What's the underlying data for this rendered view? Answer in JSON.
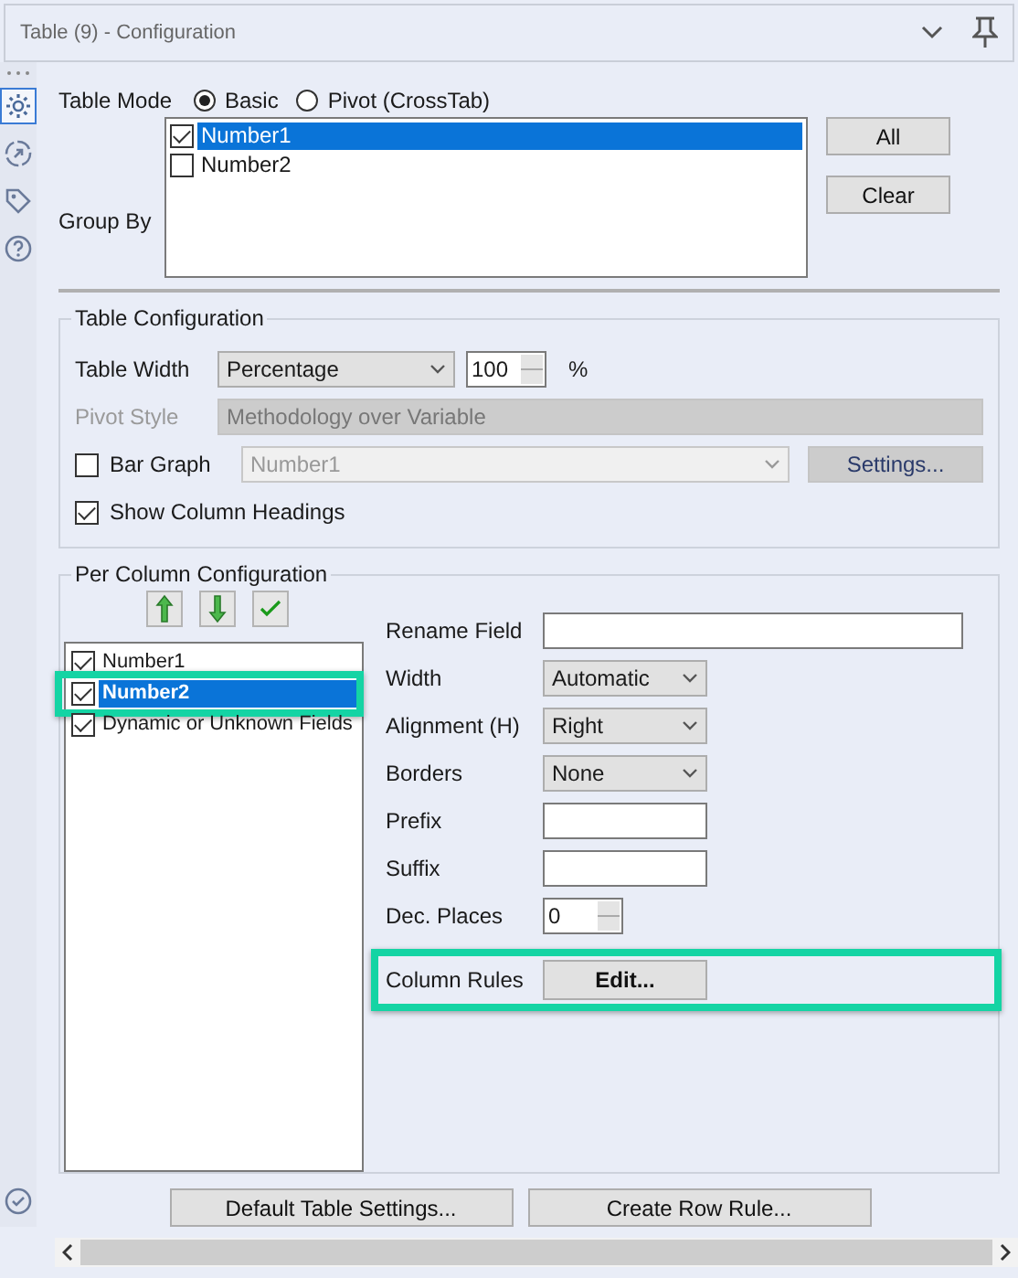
{
  "window": {
    "title": "Table (9) - Configuration"
  },
  "sidebar": {
    "items": [
      {
        "selected": true
      },
      {
        "selected": false
      },
      {
        "selected": false
      },
      {
        "selected": false
      }
    ]
  },
  "table_mode": {
    "label": "Table Mode",
    "options": [
      {
        "label": "Basic",
        "selected": true
      },
      {
        "label": "Pivot (CrossTab)",
        "selected": false
      }
    ]
  },
  "group_by": {
    "label": "Group By",
    "items": [
      {
        "label": "Number1",
        "checked": true,
        "selected": true
      },
      {
        "label": "Number2",
        "checked": false,
        "selected": false
      }
    ],
    "buttons": [
      "All",
      "Clear"
    ]
  },
  "table_configuration": {
    "title": "Table Configuration",
    "table_width": {
      "label": "Table Width",
      "value": "Percentage",
      "amount": "100",
      "unit": "%"
    },
    "pivot_style": {
      "label": "Pivot Style",
      "value": "Methodology over Variable",
      "disabled": true
    },
    "bar_graph": {
      "label": "Bar Graph",
      "checked": false,
      "value": "Number1",
      "disabled": true,
      "button": "Settings..."
    },
    "show_column_headings": {
      "label": "Show Column Headings",
      "checked": true
    }
  },
  "per_column": {
    "title": "Per Column Configuration",
    "fields": [
      {
        "label": "Number1",
        "checked": true,
        "selected": false,
        "highlighted": false
      },
      {
        "label": "Number2",
        "checked": true,
        "selected": true,
        "highlighted": true
      },
      {
        "label": "Dynamic or Unknown Fields",
        "checked": true,
        "selected": false,
        "highlighted": false
      }
    ],
    "settings": [
      {
        "kind": "text",
        "label": "Rename Field",
        "wide": true
      },
      {
        "kind": "select",
        "label": "Width",
        "value": "Automatic"
      },
      {
        "kind": "select",
        "label": "Alignment (H)",
        "value": "Right"
      },
      {
        "kind": "select",
        "label": "Borders",
        "value": "None"
      },
      {
        "kind": "text",
        "label": "Prefix"
      },
      {
        "kind": "text",
        "label": "Suffix"
      },
      {
        "kind": "spin",
        "label": "Dec. Places",
        "value": "0"
      },
      {
        "kind": "button",
        "label": "Column Rules",
        "button": "Edit...",
        "highlighted": true
      }
    ]
  },
  "buttons": [
    "Default Table Settings...",
    "Create Row Rule..."
  ]
}
